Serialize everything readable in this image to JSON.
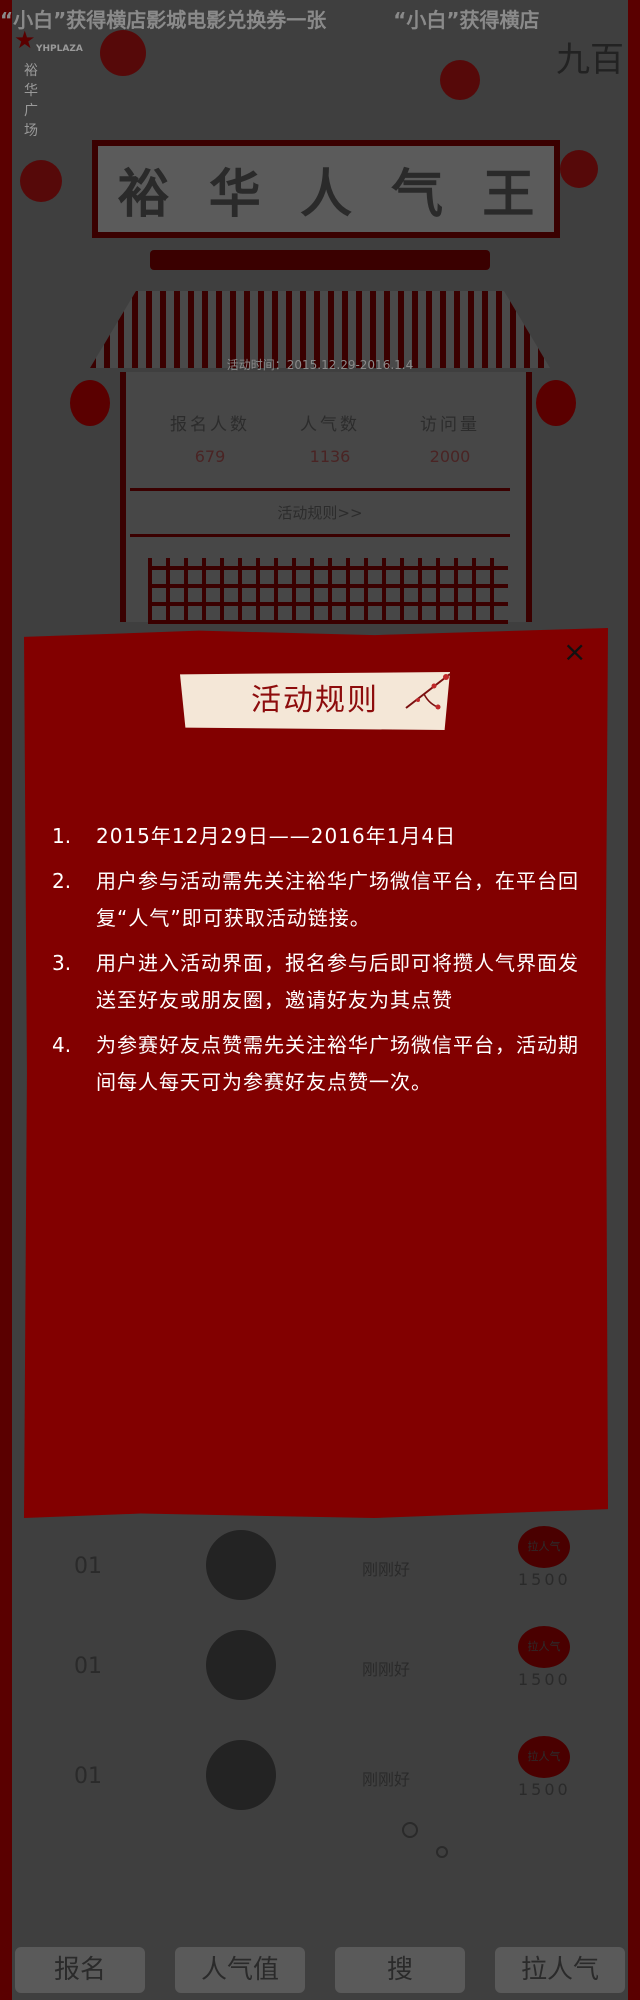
{
  "marquee": {
    "text1": "“小白”获得横店影城电影兑换券一张",
    "text2": "“小白”获得横店"
  },
  "logo": {
    "en": "YHPLAZA",
    "cn": "裕华广场"
  },
  "corner_char": "九百",
  "title_chars": [
    "裕",
    "华",
    "人",
    "气",
    "王"
  ],
  "activity_time": "活动时间：2015.12.29-2016.1.4",
  "stats": [
    {
      "label": "报名人数",
      "value": "679"
    },
    {
      "label": "人气数",
      "value": "1136"
    },
    {
      "label": "访问量",
      "value": "2000"
    }
  ],
  "rules_link": "活动规则>>",
  "ranking": [
    {
      "num": "01",
      "name": "刚刚好",
      "badge": "拉人气",
      "votes": "1500"
    },
    {
      "num": "01",
      "name": "刚刚好",
      "badge": "拉人气",
      "votes": "1500"
    },
    {
      "num": "01",
      "name": "刚刚好",
      "badge": "拉人气",
      "votes": "1500"
    }
  ],
  "bottom_nav": [
    "报名",
    "人气值",
    "搜",
    "拉人气"
  ],
  "modal": {
    "title": "活动规则",
    "close": "×",
    "rules": [
      {
        "n": "1.",
        "t": "2015年12月29日——2016年1月4日"
      },
      {
        "n": "2.",
        "t": "用户参与活动需先关注裕华广场微信平台，在平台回复“人气”即可获取活动链接。"
      },
      {
        "n": "3.",
        "t": "用户进入活动界面，报名参与后即可将攒人气界面发送至好友或朋友圈，邀请好友为其点赞"
      },
      {
        "n": "4.",
        "t": "为参赛好友点赞需先关注裕华广场微信平台，活动期间每人每天可为参赛好友点赞一次。"
      }
    ]
  }
}
